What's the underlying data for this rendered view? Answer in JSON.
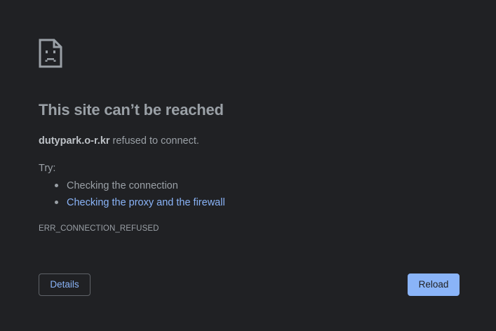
{
  "error_page": {
    "icon": "sad-document-icon",
    "title": "This site can’t be reached",
    "host": "dutypark.o-r.kr",
    "message_suffix": " refused to connect.",
    "try_label": "Try:",
    "suggestions": [
      {
        "text": "Checking the connection",
        "is_link": false
      },
      {
        "text": "Checking the proxy and the firewall",
        "is_link": true
      }
    ],
    "error_code": "ERR_CONNECTION_REFUSED"
  },
  "buttons": {
    "details_label": "Details",
    "reload_label": "Reload"
  },
  "colors": {
    "background": "#202124",
    "text": "#9aa0a6",
    "link": "#8ab4f8",
    "primary_button": "#8ab4f8",
    "border": "#5f6368"
  }
}
